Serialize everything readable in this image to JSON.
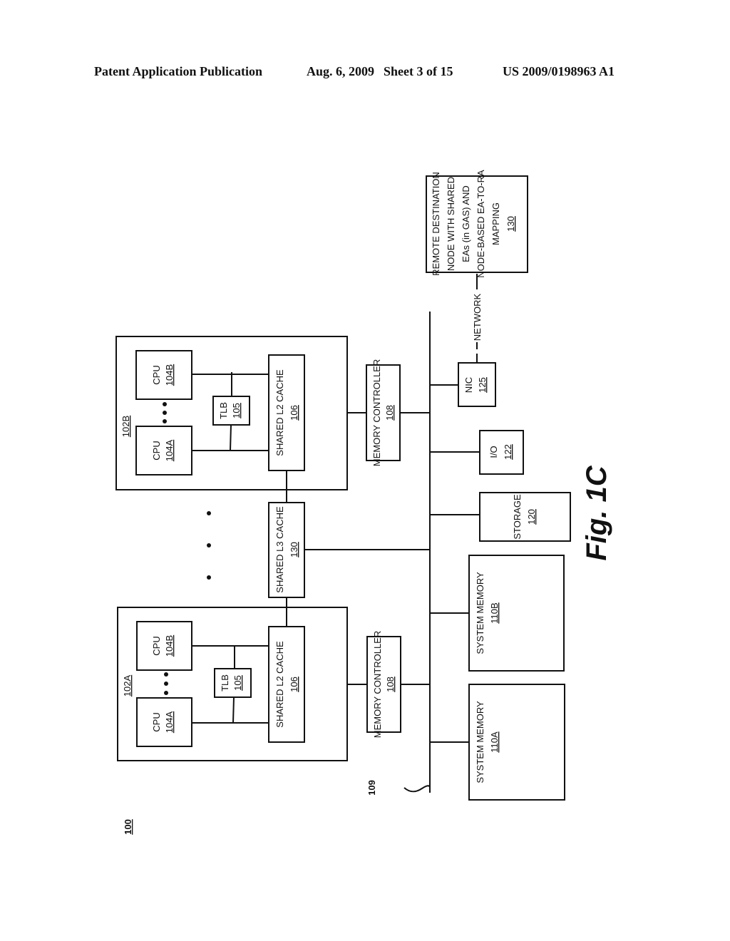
{
  "header": {
    "publication": "Patent Application Publication",
    "date": "Aug. 6, 2009",
    "sheet": "Sheet 3 of 15",
    "number": "US 2009/0198963 A1"
  },
  "figure": {
    "label": "Fig. 1C",
    "system_ref": "100",
    "bus_ref": "109",
    "node_b": {
      "ref": "102B",
      "cpu_a": {
        "label": "CPU",
        "ref": "104A"
      },
      "cpu_b": {
        "label": "CPU",
        "ref": "104B"
      },
      "tlb": {
        "label": "TLB",
        "ref": "105"
      },
      "l2": {
        "label": "SHARED L2 CACHE",
        "ref": "106"
      }
    },
    "node_a": {
      "ref": "102A",
      "cpu_a": {
        "label": "CPU",
        "ref": "104A"
      },
      "cpu_b": {
        "label": "CPU",
        "ref": "104B"
      },
      "tlb": {
        "label": "TLB",
        "ref": "105"
      },
      "l2": {
        "label": "SHARED L2 CACHE",
        "ref": "106"
      }
    },
    "l3": {
      "label": "SHARED L3 CACHE",
      "ref": "130"
    },
    "mc_b": {
      "label": "MEMORY CONTROLLER",
      "ref": "108"
    },
    "mc_a": {
      "label": "MEMORY CONTROLLER",
      "ref": "108"
    },
    "nic": {
      "label": "NIC",
      "ref": "125"
    },
    "io": {
      "label": "I/O",
      "ref": "122"
    },
    "storage": {
      "label": "STORAGE",
      "ref": "120"
    },
    "sysmem_b": {
      "label": "SYSTEM MEMORY",
      "ref": "110B"
    },
    "sysmem_a": {
      "label": "SYSTEM MEMORY",
      "ref": "110A"
    },
    "network": "NETWORK",
    "remote": {
      "lines": [
        "REMOTE DESTINATION",
        "NODE WITH SHARED",
        "EAs (in GAS) AND",
        "NODE-BASED EA-TO-RA",
        "MAPPING"
      ],
      "ref": "130"
    }
  }
}
